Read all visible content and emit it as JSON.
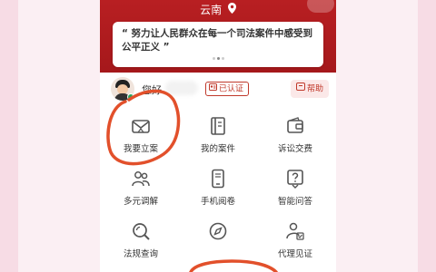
{
  "header": {
    "region": "云南",
    "quote": "“ 努力让人民群众在每一个司法案件中感受到公平正义 ”"
  },
  "user": {
    "greeting": "您好",
    "verified_label": "已认证",
    "help_label": "帮助"
  },
  "services": [
    {
      "label": "我要立案",
      "icon": "mail-icon"
    },
    {
      "label": "我的案件",
      "icon": "book-icon"
    },
    {
      "label": "诉讼交费",
      "icon": "wallet-icon"
    },
    {
      "label": "多元调解",
      "icon": "people-icon"
    },
    {
      "label": "手机阅卷",
      "icon": "phone-icon"
    },
    {
      "label": "智能问答",
      "icon": "question-icon"
    },
    {
      "label": "法规查询",
      "icon": "search-icon"
    },
    {
      "label": "",
      "icon": "compass-icon"
    },
    {
      "label": "代理见证",
      "icon": "agent-icon"
    }
  ],
  "colors": {
    "brand_red": "#b81f22",
    "annotation": "#e2502b",
    "icon": "#555555"
  }
}
